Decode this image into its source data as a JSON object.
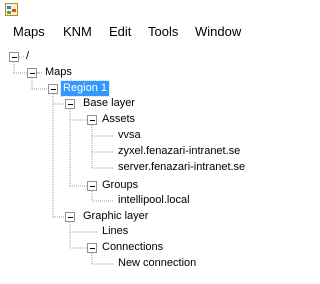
{
  "menu": {
    "items": [
      {
        "label": "Maps"
      },
      {
        "label": "KNM"
      },
      {
        "label": "Edit"
      },
      {
        "label": "Tools"
      },
      {
        "label": "Window"
      }
    ]
  },
  "tree": {
    "root": "/",
    "maps": "Maps",
    "region": "Region 1",
    "base_layer": "Base layer",
    "assets": "Assets",
    "asset_items": [
      "vvsa",
      "zyxel.fenazari-intranet.se",
      "server.fenazari-intranet.se"
    ],
    "groups": "Groups",
    "group_items": [
      "intellipool.local"
    ],
    "graphic_layer": "Graphic layer",
    "lines": "Lines",
    "connections": "Connections",
    "connection_items": [
      "New connection"
    ],
    "selected": "Region 1"
  },
  "colors": {
    "selection": "#3399ff",
    "tree_lines": "#a0a0a0"
  }
}
